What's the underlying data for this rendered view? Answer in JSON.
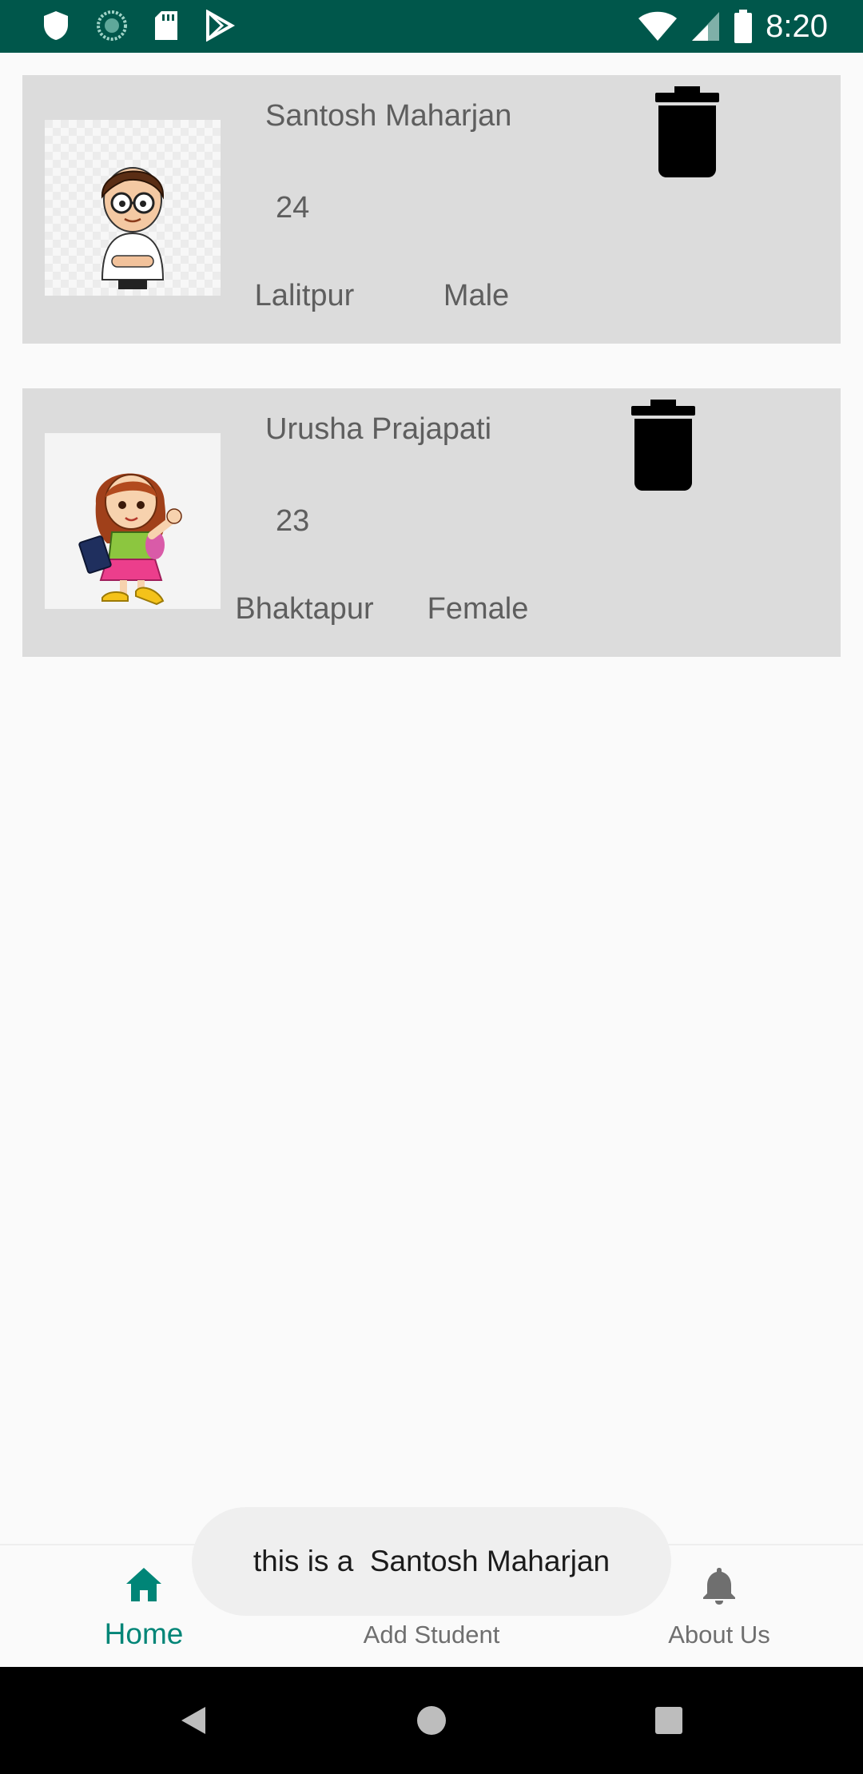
{
  "status_bar": {
    "time": "8:20",
    "left_icons": [
      "shield-icon",
      "sync-icon",
      "sd-card-icon",
      "play-store-icon"
    ],
    "right_icons": [
      "wifi-icon",
      "signal-icon",
      "battery-icon"
    ]
  },
  "students": [
    {
      "name": "Santosh Maharjan",
      "age": "24",
      "city": "Lalitpur",
      "gender": "Male",
      "avatar": "boy-avatar-icon"
    },
    {
      "name": "Urusha Prajapati",
      "age": "23",
      "city": "Bhaktapur",
      "gender": "Female",
      "avatar": "girl-avatar-icon"
    }
  ],
  "bottom_nav": {
    "items": [
      {
        "label": "Home",
        "icon": "home-icon",
        "active": true
      },
      {
        "label": "Add Student",
        "icon": "add-person-icon",
        "active": false
      },
      {
        "label": "About Us",
        "icon": "bell-icon",
        "active": false
      }
    ]
  },
  "toast": {
    "text": "this is a  Santosh Maharjan"
  },
  "colors": {
    "status_bar": "#00574b",
    "accent": "#008577",
    "card_background": "#dcdcdc"
  },
  "system_nav": [
    "back-icon",
    "home-circle-icon",
    "recents-icon"
  ]
}
